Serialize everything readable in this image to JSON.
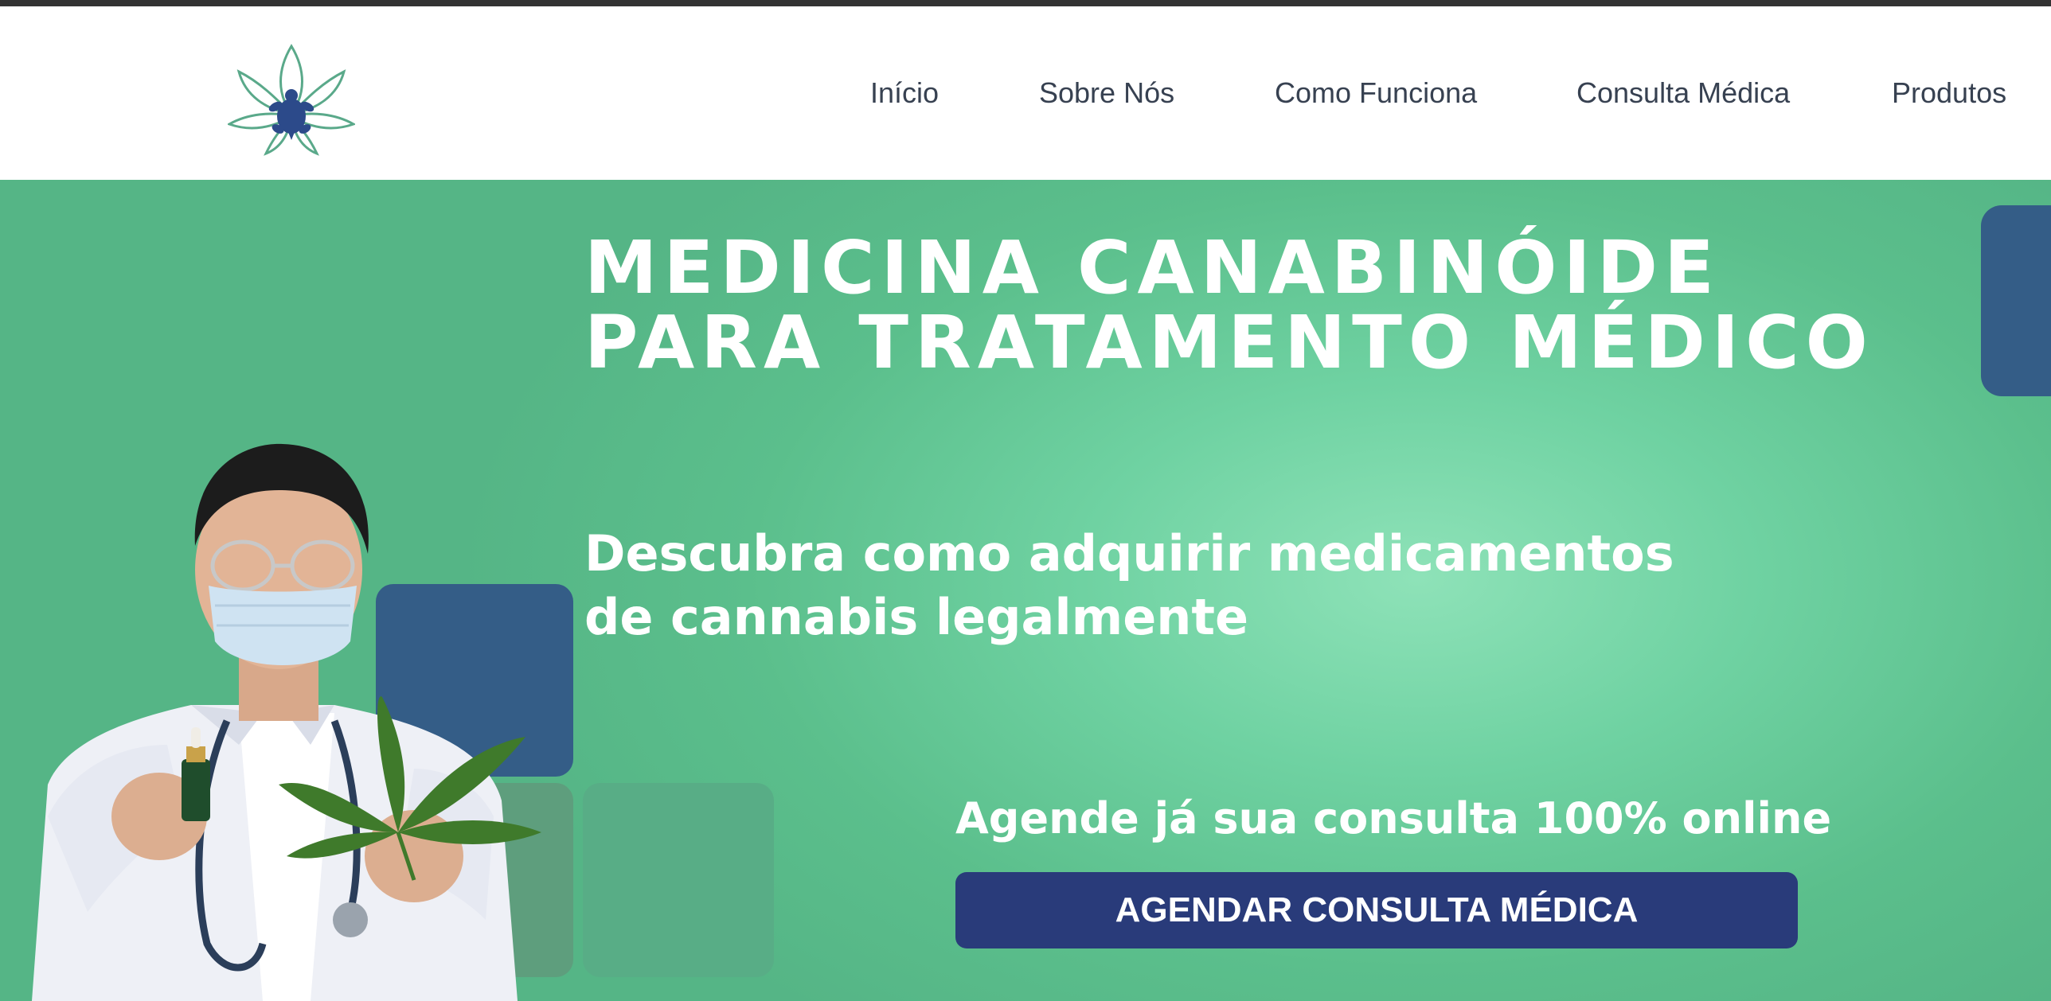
{
  "header": {
    "logo_icon": "lotus-turtle-logo-icon",
    "nav": [
      {
        "label": "Início"
      },
      {
        "label": "Sobre Nós"
      },
      {
        "label": "Como Funciona"
      },
      {
        "label": "Consulta Médica"
      },
      {
        "label": "Produtos"
      }
    ]
  },
  "hero": {
    "title_line1": "MEDICINA CANABINÓIDE",
    "title_line2": "PARA TRATAMENTO MÉDICO",
    "subtitle_line1": "Descubra como adquirir medicamentos",
    "subtitle_line2": "de cannabis legalmente",
    "cta_text": "Agende já sua consulta 100% online",
    "cta_button_label": "AGENDAR CONSULTA MÉDICA",
    "image_icon": "doctor-with-cannabis-leaf-image"
  },
  "colors": {
    "top_bar": "#333333",
    "hero_green": "#5bbf8c",
    "hero_highlight": "#8ee2b8",
    "deco_blue": "#345d87",
    "cta_button": "#293b7a",
    "logo_green": "#5aa98a",
    "logo_blue": "#2c4a8a"
  }
}
